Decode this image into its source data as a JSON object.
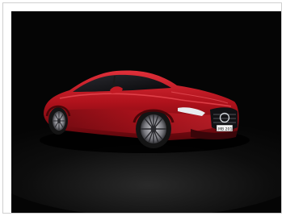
{
  "image": {
    "alt": "",
    "plate_text": "S MB 2018",
    "colors": {
      "background": "#050505",
      "body": "#b0121c",
      "body_highlight": "#e0303a",
      "body_shadow": "#5a060b",
      "glass": "#0c0c0e",
      "tire": "#141414",
      "rim": "#8e8e92",
      "chrome": "#cfd3d8"
    }
  }
}
